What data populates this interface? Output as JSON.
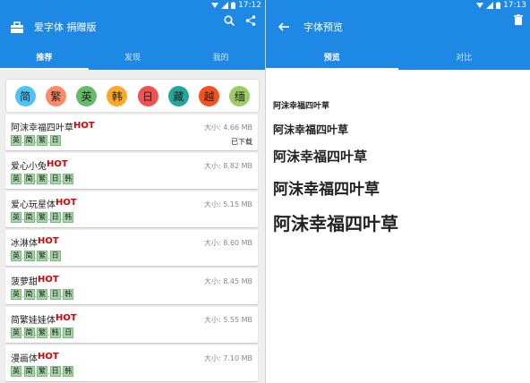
{
  "status_bar": {
    "time": "17:12",
    "time_right": "17:13"
  },
  "left": {
    "title": "爱字体 捐赠版",
    "tabs": [
      {
        "label": "推荐",
        "active": true
      },
      {
        "label": "发现",
        "active": false
      },
      {
        "label": "我的",
        "active": false
      }
    ],
    "chips": [
      {
        "label": "简",
        "color": "#4fc3f7"
      },
      {
        "label": "繁",
        "color": "#ff8a65"
      },
      {
        "label": "英",
        "color": "#66bb6a"
      },
      {
        "label": "韩",
        "color": "#ffa726"
      },
      {
        "label": "日",
        "color": "#ef5350"
      },
      {
        "label": "藏",
        "color": "#26a69a"
      },
      {
        "label": "越",
        "color": "#f4511e"
      },
      {
        "label": "缅",
        "color": "#9ccc65"
      }
    ],
    "hot_label": "HOT",
    "fonts": [
      {
        "name": "阿沫幸福四叶草",
        "size": "大小: 4.66 MB",
        "status": "已下载",
        "tags": [
          "英",
          "简",
          "繁",
          "日"
        ]
      },
      {
        "name": "爱心小兔",
        "size": "大小: 8.82 MB",
        "status": "",
        "tags": [
          "英",
          "简",
          "繁",
          "日",
          "韩"
        ]
      },
      {
        "name": "爱心玩星体",
        "size": "大小: 5.15 MB",
        "status": "",
        "tags": [
          "英",
          "简",
          "繁",
          "日",
          "韩"
        ]
      },
      {
        "name": "冰淋体",
        "size": "大小: 8.60 MB",
        "status": "",
        "tags": [
          "英",
          "简",
          "繁",
          "日"
        ]
      },
      {
        "name": "菠萝甜",
        "size": "大小: 8.45 MB",
        "status": "",
        "tags": [
          "英",
          "简",
          "繁",
          "日",
          "韩"
        ]
      },
      {
        "name": "简繁娃娃体",
        "size": "大小: 5.55 MB",
        "status": "",
        "tags": [
          "英",
          "简",
          "繁",
          "韩",
          "日"
        ]
      },
      {
        "name": "漫画体",
        "size": "大小: 7.10 MB",
        "status": "",
        "tags": [
          "英",
          "简",
          "繁",
          "日",
          "韩"
        ]
      }
    ]
  },
  "right": {
    "title": "字体预览",
    "tabs": [
      {
        "label": "预览",
        "active": true
      },
      {
        "label": "对比",
        "active": false
      }
    ],
    "preview_text": "阿沫幸福四叶草"
  }
}
